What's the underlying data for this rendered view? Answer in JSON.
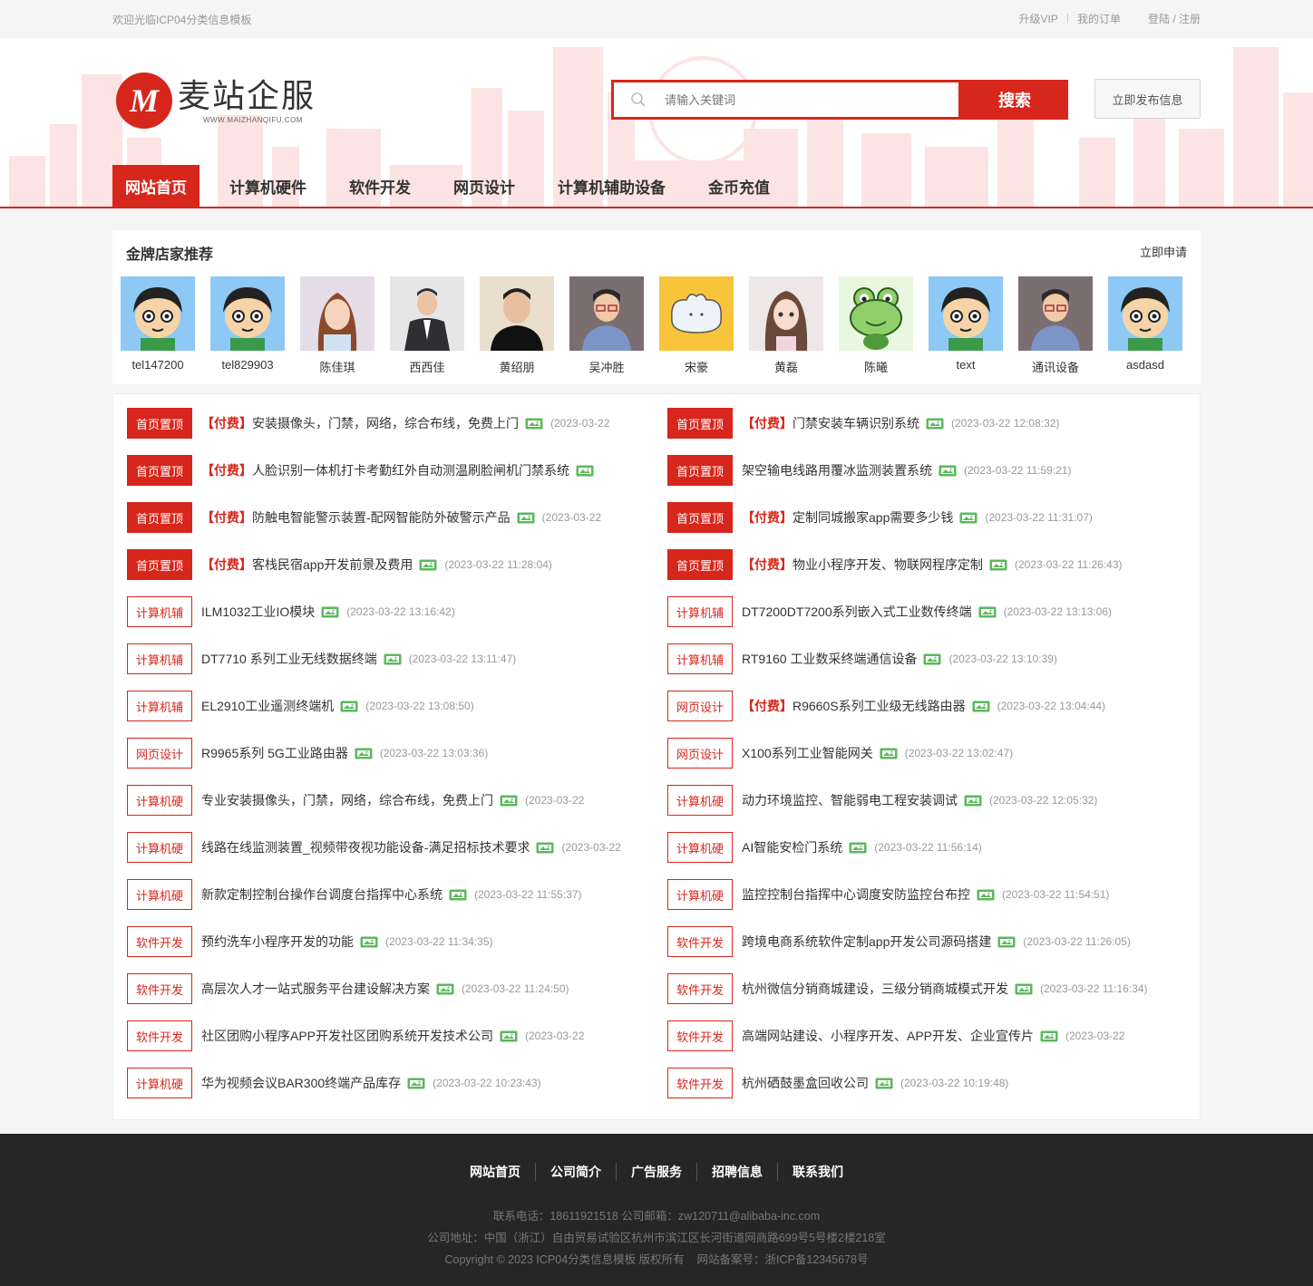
{
  "topbar": {
    "welcome": "欢迎光临ICP04分类信息模板",
    "upgrade": "升级VIP",
    "orders": "我的订单",
    "login": "登陆 / 注册"
  },
  "header": {
    "logo_mark": "M",
    "logo_name": "麦站企服",
    "logo_sub": "WWW.MAIZHANQIFU.COM",
    "search_placeholder": "请输入关键词",
    "search_button": "搜索",
    "publish_button": "立即发布信息"
  },
  "nav": [
    "网站首页",
    "计算机硬件",
    "软件开发",
    "网页设计",
    "计算机辅助设备",
    "金币充值"
  ],
  "shops": {
    "title": "金牌店家推荐",
    "apply": "立即申请",
    "items": [
      {
        "name": "tel147200",
        "avatar": "cartoon-boy"
      },
      {
        "name": "tel829903",
        "avatar": "cartoon-boy"
      },
      {
        "name": "陈佳琪",
        "avatar": "woman-illustration"
      },
      {
        "name": "西西佳",
        "avatar": "man-in-suit"
      },
      {
        "name": "黄绍朋",
        "avatar": "man-portrait"
      },
      {
        "name": "吴冲胜",
        "avatar": "man-glasses"
      },
      {
        "name": "宋豪",
        "avatar": "white-blob"
      },
      {
        "name": "黄磊",
        "avatar": "girl-illustration"
      },
      {
        "name": "陈曦",
        "avatar": "frog"
      },
      {
        "name": "text",
        "avatar": "cartoon-boy"
      },
      {
        "name": "通讯设备",
        "avatar": "man-glasses"
      },
      {
        "name": "asdasd",
        "avatar": "cartoon-boy"
      }
    ]
  },
  "listings": {
    "paid_label": "【付费】",
    "left": [
      {
        "tag": "首页置顶",
        "solid": true,
        "paid": true,
        "title": "安装摄像头，门禁，网络，综合布线，免费上门",
        "date": "(2023-03-22"
      },
      {
        "tag": "首页置顶",
        "solid": true,
        "paid": true,
        "title": "人脸识别一体机打卡考勤红外自动测温刷脸闸机门禁系统",
        "date": ""
      },
      {
        "tag": "首页置顶",
        "solid": true,
        "paid": true,
        "title": "防触电智能警示装置-配网智能防外破警示产品",
        "date": "(2023-03-22"
      },
      {
        "tag": "首页置顶",
        "solid": true,
        "paid": true,
        "title": "客栈民宿app开发前景及费用",
        "date": "(2023-03-22 11:28:04)"
      },
      {
        "tag": "计算机辅",
        "solid": false,
        "paid": false,
        "title": "ILM1032工业IO模块",
        "date": "(2023-03-22 13:16:42)"
      },
      {
        "tag": "计算机辅",
        "solid": false,
        "paid": false,
        "title": "DT7710 系列工业无线数据终端",
        "date": "(2023-03-22 13:11:47)"
      },
      {
        "tag": "计算机辅",
        "solid": false,
        "paid": false,
        "title": "EL2910工业遥测终端机",
        "date": "(2023-03-22 13:08:50)"
      },
      {
        "tag": "网页设计",
        "solid": false,
        "paid": false,
        "title": "R9965系列 5G工业路由器",
        "date": "(2023-03-22 13:03:36)"
      },
      {
        "tag": "计算机硬",
        "solid": false,
        "paid": false,
        "title": "专业安装摄像头，门禁，网络，综合布线，免费上门",
        "date": "(2023-03-22"
      },
      {
        "tag": "计算机硬",
        "solid": false,
        "paid": false,
        "title": "线路在线监测装置_视频带夜视功能设备-满足招标技术要求",
        "date": "(2023-03-22"
      },
      {
        "tag": "计算机硬",
        "solid": false,
        "paid": false,
        "title": "新款定制控制台操作台调度台指挥中心系统",
        "date": "(2023-03-22 11:55:37)"
      },
      {
        "tag": "软件开发",
        "solid": false,
        "paid": false,
        "title": "预约洗车小程序开发的功能",
        "date": "(2023-03-22 11:34:35)"
      },
      {
        "tag": "软件开发",
        "solid": false,
        "paid": false,
        "title": "高层次人才一站式服务平台建设解决方案",
        "date": "(2023-03-22 11:24:50)"
      },
      {
        "tag": "软件开发",
        "solid": false,
        "paid": false,
        "title": "社区团购小程序APP开发社区团购系统开发技术公司",
        "date": "(2023-03-22"
      },
      {
        "tag": "计算机硬",
        "solid": false,
        "paid": false,
        "title": "华为视频会议BAR300终端产品库存",
        "date": "(2023-03-22 10:23:43)"
      }
    ],
    "right": [
      {
        "tag": "首页置顶",
        "solid": true,
        "paid": true,
        "title": "门禁安装车辆识别系统",
        "date": "(2023-03-22 12:08:32)"
      },
      {
        "tag": "首页置顶",
        "solid": true,
        "paid": false,
        "title": "架空输电线路用覆冰监测装置系统",
        "date": "(2023-03-22 11:59:21)"
      },
      {
        "tag": "首页置顶",
        "solid": true,
        "paid": true,
        "title": "定制同城搬家app需要多少钱",
        "date": "(2023-03-22 11:31:07)"
      },
      {
        "tag": "首页置顶",
        "solid": true,
        "paid": true,
        "title": "物业小程序开发、物联网程序定制",
        "date": "(2023-03-22 11:26:43)"
      },
      {
        "tag": "计算机辅",
        "solid": false,
        "paid": false,
        "title": "DT7200DT7200系列嵌入式工业数传终端",
        "date": "(2023-03-22 13:13:06)"
      },
      {
        "tag": "计算机辅",
        "solid": false,
        "paid": false,
        "title": "RT9160 工业数采终端通信设备",
        "date": "(2023-03-22 13:10:39)"
      },
      {
        "tag": "网页设计",
        "solid": false,
        "paid": true,
        "title": "R9660S系列工业级无线路由器",
        "date": "(2023-03-22 13:04:44)"
      },
      {
        "tag": "网页设计",
        "solid": false,
        "paid": false,
        "title": "X100系列工业智能网关",
        "date": "(2023-03-22 13:02:47)"
      },
      {
        "tag": "计算机硬",
        "solid": false,
        "paid": false,
        "title": "动力环境监控、智能弱电工程安装调试",
        "date": "(2023-03-22 12:05:32)"
      },
      {
        "tag": "计算机硬",
        "solid": false,
        "paid": false,
        "title": "AI智能安检门系统",
        "date": "(2023-03-22 11:56:14)"
      },
      {
        "tag": "计算机硬",
        "solid": false,
        "paid": false,
        "title": "监控控制台指挥中心调度安防监控台布控",
        "date": "(2023-03-22 11:54:51)"
      },
      {
        "tag": "软件开发",
        "solid": false,
        "paid": false,
        "title": "跨境电商系统软件定制app开发公司源码搭建",
        "date": "(2023-03-22 11:26:05)"
      },
      {
        "tag": "软件开发",
        "solid": false,
        "paid": false,
        "title": "杭州微信分销商城建设，三级分销商城模式开发",
        "date": "(2023-03-22 11:16:34)"
      },
      {
        "tag": "软件开发",
        "solid": false,
        "paid": false,
        "title": "高端网站建设、小程序开发、APP开发、企业宣传片",
        "date": "(2023-03-22"
      },
      {
        "tag": "软件开发",
        "solid": false,
        "paid": false,
        "title": "杭州硒鼓墨盒回收公司",
        "date": "(2023-03-22 10:19:48)"
      }
    ]
  },
  "footer": {
    "nav": [
      "网站首页",
      "公司简介",
      "广告服务",
      "招聘信息",
      "联系我们"
    ],
    "contact": "联系电话：18611921518 公司邮箱：zw120711@alibaba-inc.com",
    "address": "公司地址：中国（浙江）自由贸易试验区杭州市滨江区长河街道网商路699号5号楼2楼218室",
    "copyright": "Copyright © 2023 ICP04分类信息模板 版权所有    网站备案号：浙ICP备12345678号"
  },
  "colors": {
    "brand_red": "#d7261b",
    "footer_bg": "#262626"
  }
}
